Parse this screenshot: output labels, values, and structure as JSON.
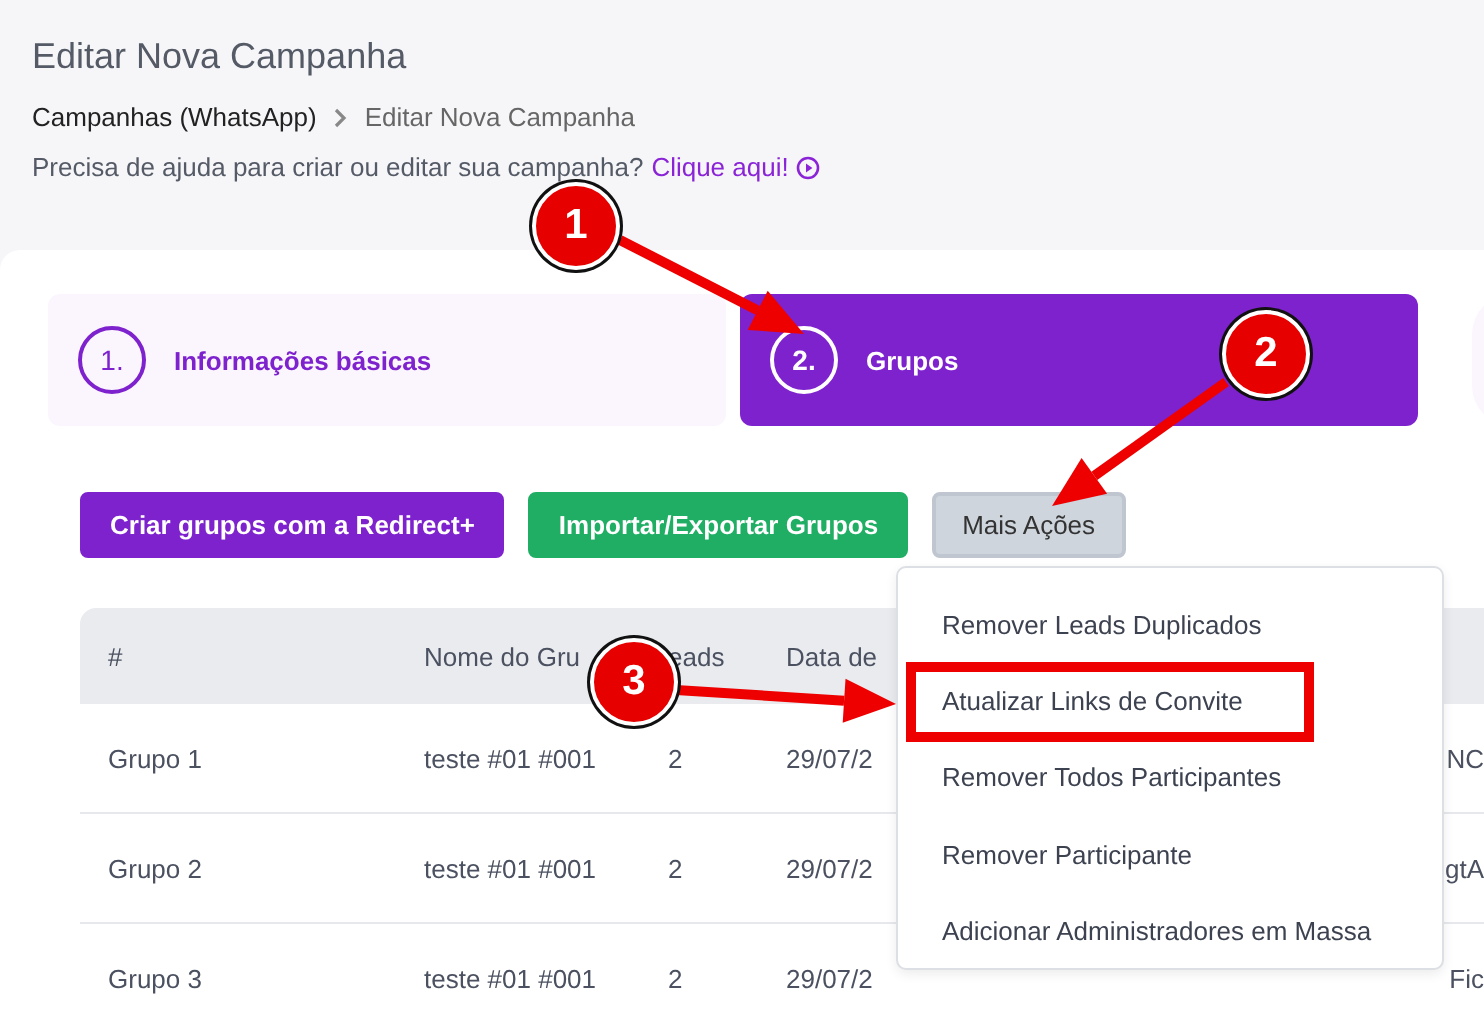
{
  "page": {
    "title": "Editar Nova Campanha",
    "breadcrumb": [
      "Campanhas (WhatsApp)",
      "Editar Nova Campanha"
    ],
    "help_text": "Precisa de ajuda para criar ou editar sua campanha?",
    "help_link": "Clique aqui!"
  },
  "steps": [
    {
      "number": "1.",
      "label": "Informações básicas",
      "selected": false
    },
    {
      "number": "2.",
      "label": "Grupos",
      "selected": true
    }
  ],
  "actions": [
    {
      "label": "Criar grupos com a Redirect+",
      "kind": "primary"
    },
    {
      "label": "Importar/Exportar Grupos",
      "kind": "success"
    },
    {
      "label": "Mais Ações",
      "kind": "secondary"
    }
  ],
  "table": {
    "columns": [
      "#",
      "Nome do Gru",
      "eads",
      "Data de"
    ],
    "rows": [
      {
        "cells": [
          "Grupo 1",
          "teste #01 #001",
          "2",
          "29/07/2",
          "NC"
        ]
      },
      {
        "cells": [
          "Grupo 2",
          "teste #01 #001",
          "2",
          "29/07/2",
          "gtA"
        ]
      },
      {
        "cells": [
          "Grupo 3",
          "teste #01 #001",
          "2",
          "29/07/2",
          "Fic"
        ]
      }
    ]
  },
  "menu": {
    "items": [
      {
        "label": "Remover Leads Duplicados",
        "highlighted": false
      },
      {
        "label": "Atualizar Links de Convite",
        "highlighted": true
      },
      {
        "label": "Remover Todos Participantes",
        "highlighted": false
      },
      {
        "label": "Remover Participante",
        "highlighted": false
      },
      {
        "label": "Adicionar Administradores em Massa",
        "highlighted": false
      }
    ]
  },
  "annotations": [
    {
      "number": "1"
    },
    {
      "number": "2"
    },
    {
      "number": "3"
    }
  ]
}
